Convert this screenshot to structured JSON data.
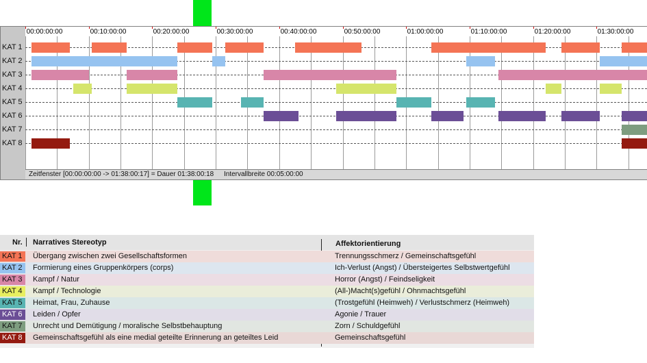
{
  "timeline": {
    "tick_labels": [
      "00:00:00:00",
      "00:10:00:00",
      "00:20:00:00",
      "00:30:00:00",
      "00:40:00:00",
      "00:50:00:00",
      "01:00:00:00",
      "01:10:00:00",
      "01:20:00:00",
      "01:30:00:00"
    ],
    "tick_minutes": [
      0,
      10,
      20,
      30,
      40,
      50,
      60,
      70,
      80,
      90
    ],
    "gridline_minutes": [
      0,
      5,
      10,
      15,
      20,
      25,
      30,
      35,
      40,
      45,
      50,
      55,
      60,
      65,
      70,
      75,
      80,
      85,
      90,
      95
    ],
    "window_start_min": 0,
    "window_end_min": 98.3,
    "categories": [
      {
        "label": "KAT 1",
        "color": "#f47455",
        "segments": [
          [
            1,
            7
          ],
          [
            10.5,
            16
          ],
          [
            24,
            29.5
          ],
          [
            31.5,
            37.5
          ],
          [
            42.5,
            53
          ],
          [
            64,
            82
          ],
          [
            84.5,
            90.5
          ],
          [
            94,
            98.3
          ]
        ]
      },
      {
        "label": "KAT 2",
        "color": "#96c3f0",
        "segments": [
          [
            1,
            24
          ],
          [
            29.5,
            31.5
          ],
          [
            69.5,
            74
          ],
          [
            90.5,
            98.3
          ]
        ]
      },
      {
        "label": "KAT 3",
        "color": "#d886a8",
        "segments": [
          [
            1,
            10
          ],
          [
            16,
            24
          ],
          [
            37.5,
            58.5
          ],
          [
            74.5,
            98.3
          ]
        ]
      },
      {
        "label": "KAT 4",
        "color": "#d5e56c",
        "segments": [
          [
            7.5,
            10.5
          ],
          [
            16,
            24
          ],
          [
            49,
            58.5
          ],
          [
            82,
            84.5
          ],
          [
            90.5,
            94
          ]
        ]
      },
      {
        "label": "KAT 5",
        "color": "#58b4b2",
        "segments": [
          [
            24,
            29.5
          ],
          [
            34,
            37.5
          ],
          [
            58.5,
            64
          ],
          [
            69.5,
            74
          ]
        ]
      },
      {
        "label": "KAT 6",
        "color": "#6b4e96",
        "segments": [
          [
            37.5,
            43
          ],
          [
            49,
            58.5
          ],
          [
            64,
            69
          ],
          [
            74.5,
            82
          ],
          [
            84.5,
            90.5
          ],
          [
            94,
            98.3
          ]
        ]
      },
      {
        "label": "KAT 7",
        "color": "#7e9d80",
        "segments": [
          [
            94,
            98.3
          ]
        ]
      },
      {
        "label": "KAT 8",
        "color": "#941a10",
        "segments": [
          [
            1,
            7
          ],
          [
            94,
            98.3
          ]
        ]
      }
    ],
    "status": {
      "window": "Zeitfenster [00:00:00:00 -> 01:38:00:17] = Dauer 01:38:00:18",
      "interval": "Intervallbreite 00:05:00:00"
    }
  },
  "legend": {
    "header_nr": "Nr.",
    "header_stereotyp": "Narratives Stereotyp",
    "header_affekt": "Affektorientierung",
    "rows": [
      {
        "nr": "KAT 1",
        "stereotyp": "Übergang zwischen zwei Gesellschaftsformen",
        "affekt": "Trennungsschmerz / Gemeinschaftsgefühl",
        "color": "#f47455",
        "row_bg": "#efdcda"
      },
      {
        "nr": "KAT 2",
        "stereotyp": "Formierung eines Gruppenkörpers (corps)",
        "affekt": "Ich-Verlust (Angst) / Übersteigertes Selbstwertgefühl",
        "color": "#96c3f0",
        "row_bg": "#dde6ef"
      },
      {
        "nr": "KAT 3",
        "stereotyp": "Kampf / Natur",
        "affekt": "Horror (Angst) / Feindseligkeit",
        "color": "#d886a8",
        "row_bg": "#ecdde4"
      },
      {
        "nr": "KAT 4",
        "stereotyp": "Kampf / Technologie",
        "affekt": "(All-)Macht(s)gefühl / Ohnmachtsgefühl",
        "color": "#e8ef60",
        "row_bg": "#eaedda"
      },
      {
        "nr": "KAT 5",
        "stereotyp": "Heimat, Frau, Zuhause",
        "affekt": "(Trostgefühl (Heimweh) / Verlustschmerz (Heimweh)",
        "color": "#58b4b2",
        "row_bg": "#dbe7e6"
      },
      {
        "nr": "KAT 6",
        "stereotyp": "Leiden / Opfer",
        "affekt": "Agonie / Trauer",
        "color": "#6b4e96",
        "row_bg": "#e1dde8"
      },
      {
        "nr": "KAT 7",
        "stereotyp": "Unrecht und Demütigung / moralische Selbstbehauptung",
        "affekt": "Zorn / Schuldgefühl",
        "color": "#7e9d80",
        "row_bg": "#e1e6e1"
      },
      {
        "nr": "KAT 8",
        "stereotyp": "Gemeinschaftsgefühl als eine medial geteilte Erinnerung an geteiltes Leid",
        "affekt": "Gemeinschaftsgefühl",
        "color": "#941a10",
        "row_bg": "#e9d8d6"
      }
    ]
  }
}
